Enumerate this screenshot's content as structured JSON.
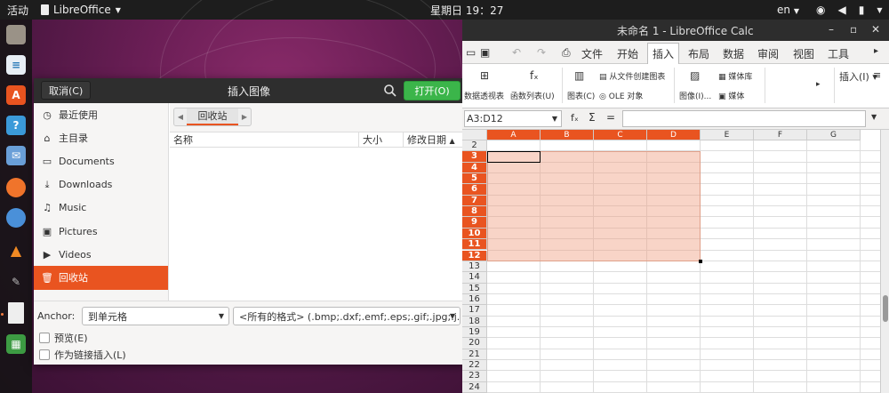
{
  "topbar": {
    "activities": "活动",
    "app_name": "LibreOffice",
    "clock": "星期日 19：27",
    "language": "en"
  },
  "dialog": {
    "cancel_label": "取消(C)",
    "title": "插入图像",
    "open_label": "打开(O)",
    "places": [
      {
        "icon": "clock-icon",
        "label": "最近使用"
      },
      {
        "icon": "home-icon",
        "label": "主目录"
      },
      {
        "icon": "folder-icon",
        "label": "Documents"
      },
      {
        "icon": "download-icon",
        "label": "Downloads"
      },
      {
        "icon": "music-icon",
        "label": "Music"
      },
      {
        "icon": "pictures-icon",
        "label": "Pictures"
      },
      {
        "icon": "video-icon",
        "label": "Videos"
      },
      {
        "icon": "trash-icon",
        "label": "回收站",
        "selected": true
      }
    ],
    "path_segment": "回收站",
    "columns": {
      "name": "名称",
      "size": "大小",
      "modified": "修改日期"
    },
    "anchor_label": "Anchor:",
    "anchor_value": "到单元格",
    "filter_value": "<所有的格式> (.bmp;.dxf;.emf;.eps;.gif;.jpg;.j...",
    "preview_label": "预览(E)",
    "link_label": "作为链接插入(L)"
  },
  "calc": {
    "title": "未命名 1 - LibreOffice Calc",
    "menus": [
      "文件",
      "开始",
      "插入",
      "布局",
      "数据",
      "审阅",
      "视图",
      "工具"
    ],
    "active_menu": "插入",
    "toolbar": {
      "pivot": "数据透视表",
      "function_list": "函数列表(U)",
      "chart": "图表(C)",
      "chart_from_file": "从文件创建图表",
      "ole": "OLE 对象",
      "image": "图像(I)...",
      "gallery": "媒体库",
      "media": "媒体",
      "insert_more": "插入(I)"
    },
    "name_box": "A3:D12",
    "columns": [
      "A",
      "B",
      "C",
      "D",
      "E",
      "F",
      "G"
    ],
    "rows": [
      "2",
      "3",
      "4",
      "5",
      "6",
      "7",
      "8",
      "9",
      "10",
      "11",
      "12",
      "13",
      "14",
      "15",
      "16",
      "17",
      "18",
      "19",
      "20",
      "21",
      "22",
      "23",
      "24"
    ],
    "selected_columns": [
      "A",
      "B",
      "C",
      "D"
    ],
    "selected_rows": [
      "3",
      "4",
      "5",
      "6",
      "7",
      "8",
      "9",
      "10",
      "11",
      "12"
    ]
  },
  "colors": {
    "accent": "#e95420",
    "open_button": "#3bb54a",
    "selection_fill": "#f5c5b3"
  }
}
